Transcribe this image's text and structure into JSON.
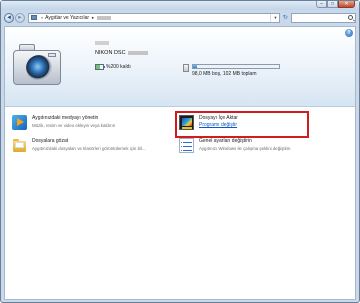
{
  "window": {
    "controls": {
      "minimize": "–",
      "maximize": "□",
      "close": "✕"
    }
  },
  "navigation": {
    "back_icon": "◄",
    "forward_icon": "►",
    "breadcrumb_root": "«",
    "breadcrumb_item": "Aygıtlar ve Yazıcılar",
    "refresh_icon": "↻",
    "dropdown_icon": "▼",
    "search_placeholder": ""
  },
  "header": {
    "help_icon": "?"
  },
  "device": {
    "name": "NIKON DSC",
    "battery_text": "%200 kaldı",
    "battery_level_percent": 60,
    "storage_used_fraction": 0.05,
    "storage_text": "98,0 MB boş, 102 MB toplam"
  },
  "tasks": [
    {
      "title": "Aygıtınızdaki medyayı yönetin",
      "desc": "Müzik, resim ve video ekleyin veya kaldırın"
    },
    {
      "title": "Dosyalara gözat",
      "desc": "Aygıtınızdaki dosyaları ve klasörleri görüntülemek için bil..."
    },
    {
      "title": "Dosyayı İçe Aktar",
      "link": "Programı değiştir"
    },
    {
      "title": "Genel ayarları değiştirin",
      "desc": "Aygıtınızı Windows ile çalışma şeklini değiştirin"
    }
  ],
  "colors": {
    "highlight_border": "#d01c1c",
    "link": "#0b59c6",
    "chrome": "#c9d9ea"
  }
}
